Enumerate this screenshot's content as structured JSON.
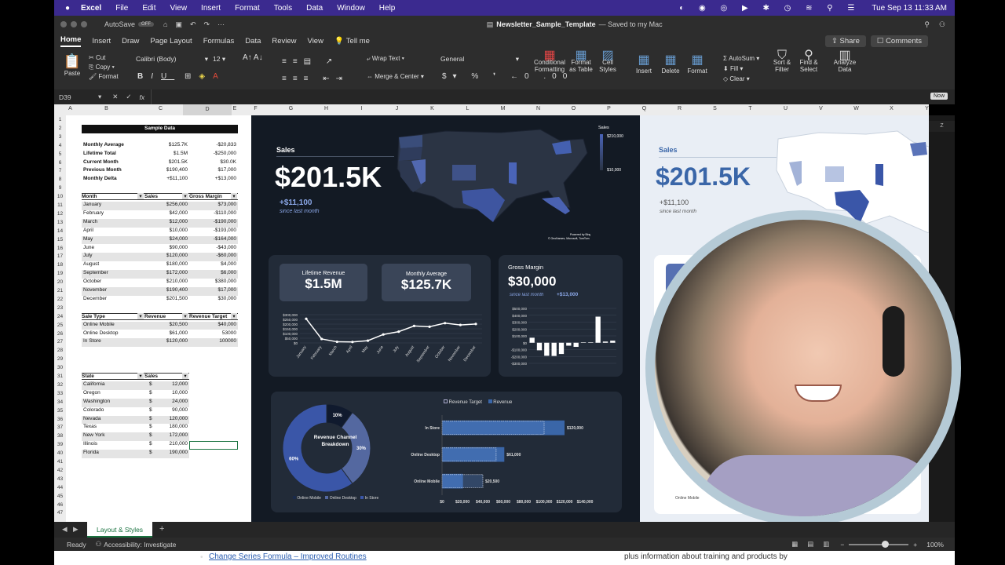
{
  "menubar": {
    "app": "Excel",
    "items": [
      "File",
      "Edit",
      "View",
      "Insert",
      "Format",
      "Tools",
      "Data",
      "Window",
      "Help"
    ],
    "clock": "Tue Sep 13  11:33 AM"
  },
  "titlebar": {
    "autosave": "AutoSave",
    "autosave_state": "OFF",
    "doc_title": "Newsletter_Sample_Template",
    "saved": "— Saved to my Mac"
  },
  "ribbon_tabs": [
    "Home",
    "Insert",
    "Draw",
    "Page Layout",
    "Formulas",
    "Data",
    "Review",
    "View",
    "Tell me"
  ],
  "ribbon_right": {
    "share": "Share",
    "comments": "Comments"
  },
  "ribbon": {
    "paste": "Paste",
    "cut": "Cut",
    "copy": "Copy",
    "format": "Format",
    "font": "Calibri (Body)",
    "size": "12",
    "wrap": "Wrap Text",
    "merge": "Merge & Center",
    "numfmt": "General",
    "cond": "Conditional Formatting",
    "fmt_table": "Format as Table",
    "cell_styles": "Cell Styles",
    "insert": "Insert",
    "delete": "Delete",
    "format2": "Format",
    "autosum": "AutoSum",
    "fill": "Fill",
    "clear": "Clear",
    "sort": "Sort & Filter",
    "find": "Find & Select",
    "analyze": "Analyze Data"
  },
  "formulabar": {
    "namebox": "D39",
    "fx": "fx"
  },
  "columns": [
    "A",
    "B",
    "C",
    "D",
    "E",
    "F",
    "G",
    "H",
    "I",
    "J",
    "K",
    "L",
    "M",
    "N",
    "O",
    "P",
    "Q",
    "R",
    "S",
    "T",
    "U",
    "V",
    "W",
    "X",
    "Y"
  ],
  "sheet": {
    "sample_header": "Sample Data",
    "summary": [
      [
        "Monthly Average",
        "$125.7K",
        "-$20,833"
      ],
      [
        "Lifetime Total",
        "$1.5M",
        "-$250,000"
      ],
      [
        "Current Month",
        "$201.5K",
        "$30.0K"
      ],
      [
        "Previous Month",
        "$190,400",
        "$17,000"
      ],
      [
        "Monthly Delta",
        "+$11,100",
        "+$13,000"
      ]
    ],
    "month_headers": [
      "Month",
      "Sales",
      "Gross Margin"
    ],
    "months": [
      [
        "January",
        "$256,000",
        "$73,000"
      ],
      [
        "February",
        "$42,000",
        "-$110,000"
      ],
      [
        "March",
        "$12,000",
        "-$190,000"
      ],
      [
        "April",
        "$10,000",
        "-$193,000"
      ],
      [
        "May",
        "$24,000",
        "-$164,000"
      ],
      [
        "June",
        "$90,000",
        "-$43,000"
      ],
      [
        "July",
        "$120,000",
        "-$60,000"
      ],
      [
        "August",
        "$180,000",
        "$4,000"
      ],
      [
        "September",
        "$172,000",
        "$6,000"
      ],
      [
        "October",
        "$210,000",
        "$380,000"
      ],
      [
        "November",
        "$190,400",
        "$17,000"
      ],
      [
        "December",
        "$201,500",
        "$30,000"
      ]
    ],
    "sale_headers": [
      "Sale Type",
      "Revenue",
      "Revenue Target"
    ],
    "sales": [
      [
        "Online Mobile",
        "$20,500",
        "$40,000"
      ],
      [
        "Online Desktop",
        "$61,000",
        "53000"
      ],
      [
        "In Store",
        "$120,000",
        "100000"
      ]
    ],
    "state_headers": [
      "State",
      "Sales"
    ],
    "states": [
      [
        "California",
        "$",
        "12,000"
      ],
      [
        "Oregon",
        "$",
        "10,000"
      ],
      [
        "Washington",
        "$",
        "24,000"
      ],
      [
        "Colorado",
        "$",
        "90,000"
      ],
      [
        "Nevada",
        "$",
        "120,000"
      ],
      [
        "Texas",
        "$",
        "180,000"
      ],
      [
        "New York",
        "$",
        "172,000"
      ],
      [
        "Illinois",
        "$",
        "210,000"
      ],
      [
        "Florida",
        "$",
        "190,000"
      ]
    ]
  },
  "dashboard": {
    "sales_label": "Sales",
    "sales_value": "$201.5K",
    "sales_delta": "+$11,100",
    "since": "since last month",
    "map_legend_title": "Sales",
    "map_legend_max": "$210,000",
    "map_legend_min": "$10,000",
    "map_credit": "Powered by Bing",
    "map_copyright": "© GeoNames, Microsoft, TomTom",
    "lifetime_label": "Lifetime Revenue",
    "lifetime_value": "$1.5M",
    "monthly_label": "Monthly Average",
    "monthly_value": "$125.7K",
    "gm_label": "Gross Margin",
    "gm_value": "$30,000",
    "gm_since": "since last month",
    "gm_delta": "+$13,000",
    "donut_title": "Revenue Channel Breakdown",
    "donut_labels": [
      "10%",
      "30%",
      "60%"
    ],
    "donut_legend": [
      "Online Mobile",
      "Online Desktop",
      "In Store"
    ],
    "bar_legend": [
      "Revenue Target",
      "Revenue"
    ]
  },
  "light": {
    "sales_label": "Sales",
    "sales_value": "$201.5K",
    "sales_delta": "+$11,100",
    "since": "since last month",
    "legend": "Online Mobile"
  },
  "sheettab": "Layout & Styles",
  "status": {
    "ready": "Ready",
    "accessibility": "Accessibility: Investigate",
    "zoom": "100%"
  },
  "below": {
    "link": "Change Series Formula – Improved Routines",
    "text": "plus information about training and products by"
  },
  "colors": {
    "accent": "#3b5aa8",
    "dark_bg": "#131a24",
    "panel": "#222b38",
    "menubar": "#3b2a8f"
  },
  "chart_data": [
    {
      "type": "line",
      "categories": [
        "January",
        "February",
        "March",
        "April",
        "May",
        "June",
        "July",
        "August",
        "September",
        "October",
        "November",
        "December"
      ],
      "values": [
        256000,
        42000,
        12000,
        10000,
        24000,
        90000,
        120000,
        180000,
        172000,
        210000,
        190400,
        201500
      ],
      "yticks": [
        "$300,000",
        "$250,000",
        "$200,000",
        "$150,000",
        "$100,000",
        "$50,000",
        "$0"
      ],
      "ylim": [
        0,
        300000
      ]
    },
    {
      "type": "bar",
      "categories": [
        "January",
        "February",
        "March",
        "April",
        "May",
        "June",
        "July",
        "August",
        "September",
        "October",
        "November",
        "December"
      ],
      "values": [
        73000,
        -110000,
        -190000,
        -193000,
        -164000,
        -43000,
        -60000,
        4000,
        6000,
        380000,
        17000,
        30000
      ],
      "yticks": [
        "$500,000",
        "$400,000",
        "$300,000",
        "$200,000",
        "$100,000",
        "$0",
        "-$100,000",
        "-$200,000",
        "-$300,000"
      ],
      "ylim": [
        -300000,
        500000
      ]
    },
    {
      "type": "pie",
      "categories": [
        "Online Mobile",
        "Online Desktop",
        "In Store"
      ],
      "values": [
        10,
        30,
        60
      ]
    },
    {
      "type": "bar",
      "categories": [
        "In Store",
        "Online Desktop",
        "Online Mobile"
      ],
      "series": [
        {
          "name": "Revenue Target",
          "values": [
            100000,
            53000,
            40000
          ]
        },
        {
          "name": "Revenue",
          "values": [
            120000,
            61000,
            20500
          ]
        }
      ],
      "data_labels": [
        "$120,000",
        "$61,000",
        "$20,500"
      ],
      "xticks": [
        "$0",
        "$20,000",
        "$40,000",
        "$60,000",
        "$80,000",
        "$100,000",
        "$120,000",
        "$140,000"
      ],
      "xlim": [
        0,
        140000
      ]
    }
  ]
}
